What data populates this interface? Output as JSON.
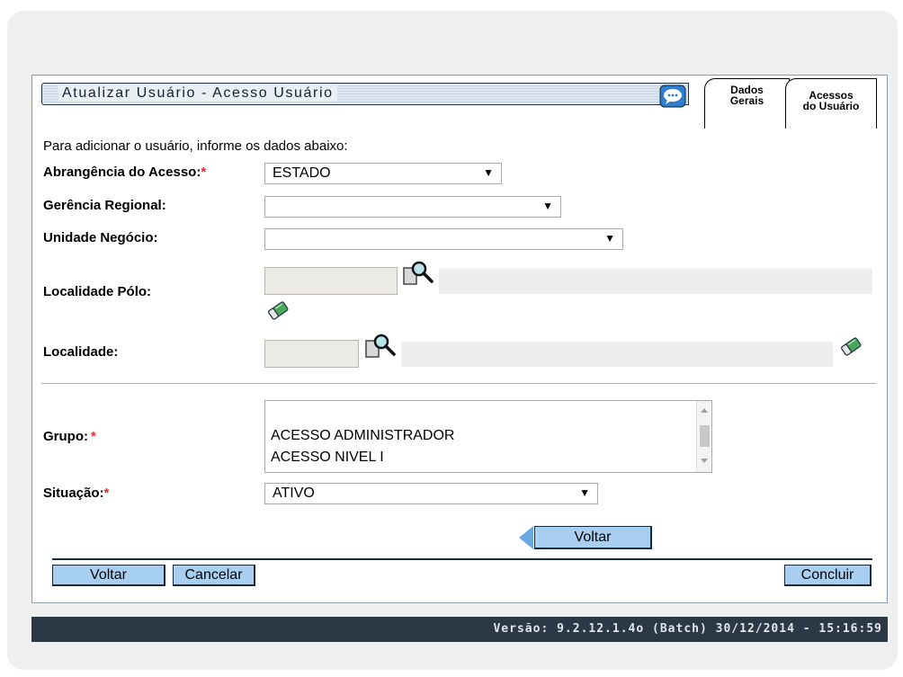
{
  "header": {
    "title": "Atualizar Usuário - Acesso Usuário",
    "chat_icon": "chat-bubble-icon"
  },
  "tabs": [
    {
      "line1": "Dados",
      "line2": "Gerais"
    },
    {
      "line1": "Acessos",
      "line2": "do Usuário"
    }
  ],
  "form": {
    "instruction": "Para adicionar o usuário, informe os dados abaixo:",
    "abrangencia": {
      "label": "Abrangência do Acesso:",
      "required": "*",
      "value": "ESTADO"
    },
    "gerencia": {
      "label": "Gerência Regional:",
      "value": ""
    },
    "unidade": {
      "label": "Unidade Negócio:",
      "value": ""
    },
    "localidade_polo": {
      "label": "Localidade Pólo:",
      "value": "",
      "description": ""
    },
    "localidade": {
      "label": "Localidade:",
      "value": "",
      "description": ""
    },
    "grupo": {
      "label": "Grupo:",
      "required": "*",
      "options": [
        "ACESSO ADMINISTRADOR",
        "ACESSO NIVEL I"
      ]
    },
    "situacao": {
      "label": "Situação:",
      "required": "*",
      "value": "ATIVO"
    }
  },
  "buttons": {
    "inner_back": "Voltar",
    "back": "Voltar",
    "cancel": "Cancelar",
    "finish": "Concluir"
  },
  "footer": {
    "version": "Versão: 9.2.12.1.4o (Batch) 30/12/2014 - 15:16:59"
  },
  "colors": {
    "button_bg": "#a8cff0",
    "footer_bg": "#2b3846",
    "required": "#e23030"
  },
  "icons": {
    "search": "magnifier-icon",
    "clear": "eraser-icon"
  }
}
